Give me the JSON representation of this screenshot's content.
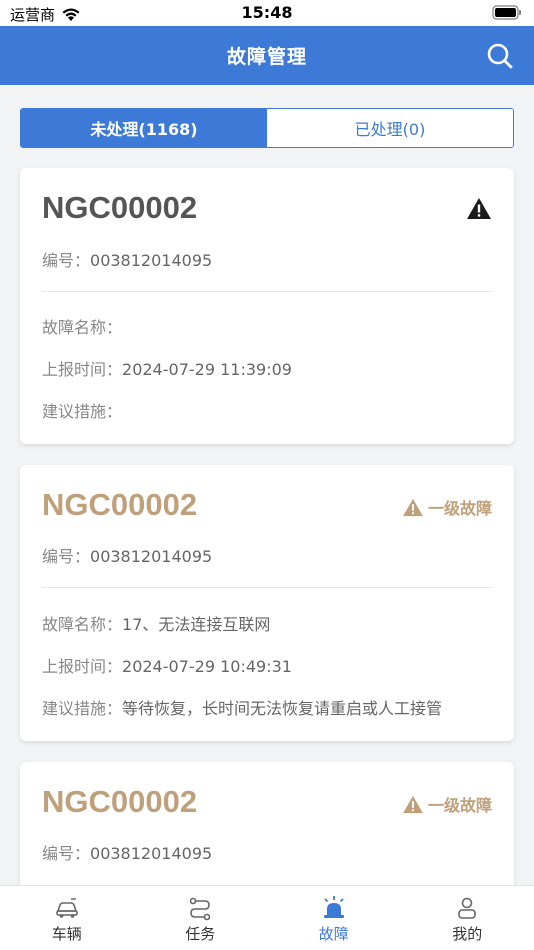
{
  "status_bar": {
    "carrier": "运营商",
    "time": "15:48"
  },
  "nav": {
    "title": "故障管理",
    "search_icon": "search-icon"
  },
  "tabs": [
    {
      "label": "未处理(1168)",
      "active": true
    },
    {
      "label": "已处理(0)",
      "active": false
    }
  ],
  "labels": {
    "code": "编号：",
    "fault_name": "故障名称：",
    "report_time": "上报时间：",
    "suggestion": "建议措施："
  },
  "faults": [
    {
      "device": "NGC00002",
      "code": "003812014095",
      "level": "",
      "fault_name": "",
      "report_time": "2024-07-29 11:39:09",
      "suggestion": ""
    },
    {
      "device": "NGC00002",
      "code": "003812014095",
      "level": "一级故障",
      "fault_name": "17、无法连接互联网",
      "report_time": "2024-07-29 10:49:31",
      "suggestion": "等待恢复，长时间无法恢复请重启或人工接管"
    },
    {
      "device": "NGC00002",
      "code": "003812014095",
      "level": "一级故障"
    }
  ],
  "tab_bar": [
    {
      "label": "车辆",
      "icon": "car-icon",
      "active": false
    },
    {
      "label": "任务",
      "icon": "route-icon",
      "active": false
    },
    {
      "label": "故障",
      "icon": "alarm-light-icon",
      "active": true
    },
    {
      "label": "我的",
      "icon": "user-icon",
      "active": false
    }
  ],
  "colors": {
    "primary": "#3d7ad8",
    "fault_level": "#bfa07a"
  }
}
